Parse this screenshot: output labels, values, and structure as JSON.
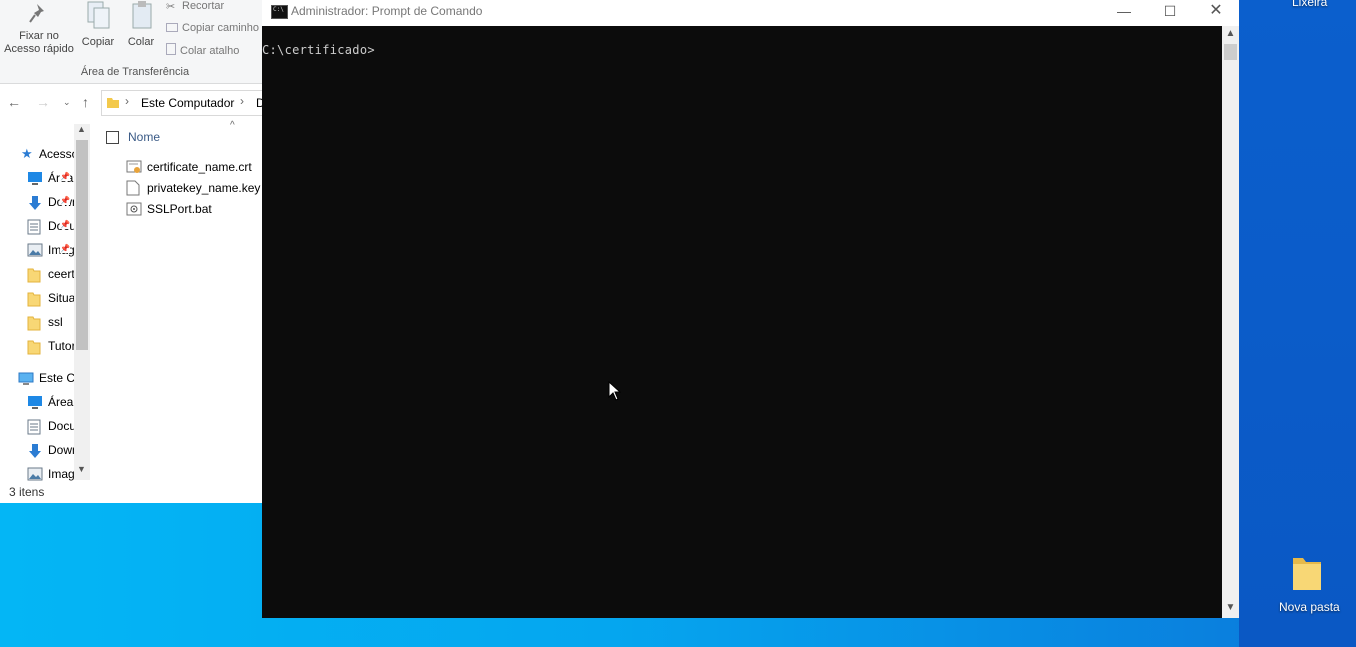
{
  "desktop": {
    "recycle_bin_label": "Lixeira",
    "new_folder_label": "Nova pasta"
  },
  "explorer": {
    "ribbon": {
      "pin_label_1": "Fixar no",
      "pin_label_2": "Acesso rápido",
      "copy_label": "Copiar",
      "paste_label": "Colar",
      "cut_label": "Recortar",
      "copy_path_label": "Copiar caminho",
      "paste_shortcut_label": "Colar atalho",
      "group_label": "Área de Transferência"
    },
    "breadcrumb": {
      "this_pc": "Este Computador",
      "next": "D"
    },
    "nav": {
      "quick_access": "Acesso rápido",
      "items": [
        {
          "label": "Área de Trabalho",
          "icon": "desktop-icon"
        },
        {
          "label": "Downloads",
          "icon": "download-icon"
        },
        {
          "label": "Documentos",
          "icon": "documents-icon"
        },
        {
          "label": "Imagens",
          "icon": "pictures-icon"
        },
        {
          "label": "ceertificado",
          "icon": "folder-icon"
        },
        {
          "label": "Situação",
          "icon": "folder-icon"
        },
        {
          "label": "ssl",
          "icon": "folder-icon"
        },
        {
          "label": "Tutorial",
          "icon": "folder-icon"
        }
      ],
      "this_pc": "Este Computador",
      "pc_items": [
        {
          "label": "Área de Trabalho",
          "icon": "desktop-icon"
        },
        {
          "label": "Documentos",
          "icon": "documents-icon"
        },
        {
          "label": "Downloads",
          "icon": "download-icon"
        },
        {
          "label": "Imagens",
          "icon": "pictures-icon"
        }
      ]
    },
    "column_header": "Nome",
    "files": [
      {
        "name": "certificate_name.crt",
        "icon": "certificate-file-icon"
      },
      {
        "name": "privatekey_name.key",
        "icon": "blank-file-icon"
      },
      {
        "name": "SSLPort.bat",
        "icon": "batch-file-icon"
      }
    ],
    "status": "3 itens"
  },
  "cmd": {
    "title": "Administrador: Prompt de Comando",
    "prompt": "C:\\certificado>"
  },
  "colors": {
    "console_bg": "#0c0c0c",
    "console_text": "#cccccc",
    "desktop_blue": "#0a8ee6"
  }
}
